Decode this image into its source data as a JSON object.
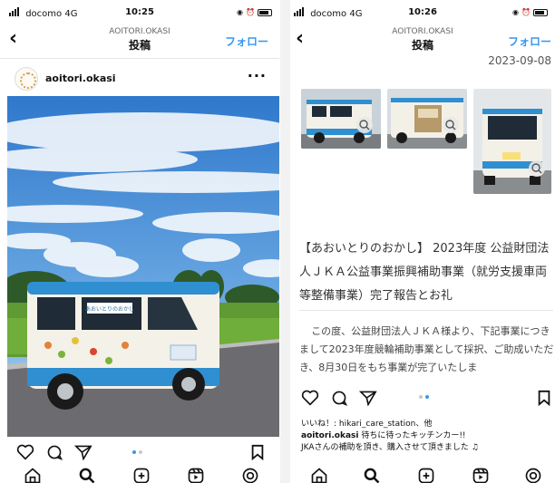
{
  "left": {
    "status": {
      "carrier": "docomo",
      "network": "4G",
      "time": "10:25"
    },
    "nav": {
      "subtitle": "AOITORI.OKASI",
      "title": "投稿",
      "follow": "フォロー"
    },
    "user": {
      "name": "aoitori.okasi",
      "more": "···"
    },
    "photo": {
      "subject": "white kei van with blue trim and vegetable stickers under a blue sky",
      "van_sign": "あおいとりのおかし"
    },
    "carousel": {
      "count": 2,
      "active": 0
    }
  },
  "right": {
    "status": {
      "carrier": "docomo",
      "network": "4G",
      "time": "10:26"
    },
    "nav": {
      "subtitle": "AOITORI.OKASI",
      "title": "投稿",
      "follow": "フォロー"
    },
    "date": "2023-09-08",
    "title": "【あおいとりのおかし】 2023年度 公益財団法人ＪＫＡ公益事業振興補助事業（就労支援車両等整備事業）完了報告とお礼",
    "body": "この度、公益財団法人ＪＫＡ様より、下記事業につきまして2023年度競輪補助事業として採択、ご助成いただき、8月30日をもち事業が完了いたしま",
    "likes": "いいね！: hikari_care_station、他",
    "caption_user": "aoitori.okasi",
    "caption_line1": " 待ちに待ったキッチンカー!!",
    "caption_line2": "JKAさんの補助を頂き、購入させて頂きました ♫",
    "carousel": {
      "count": 2,
      "active": 0
    }
  },
  "colors": {
    "accent": "#3897f0",
    "van_blue": "#2f8fd0",
    "sky": "#3a7fd0"
  },
  "icons": [
    "back-icon",
    "more-icon",
    "heart-icon",
    "comment-icon",
    "share-icon",
    "bookmark-icon",
    "home-icon",
    "search-icon",
    "add-icon",
    "reels-icon",
    "profile-icon",
    "zoom-icon"
  ]
}
